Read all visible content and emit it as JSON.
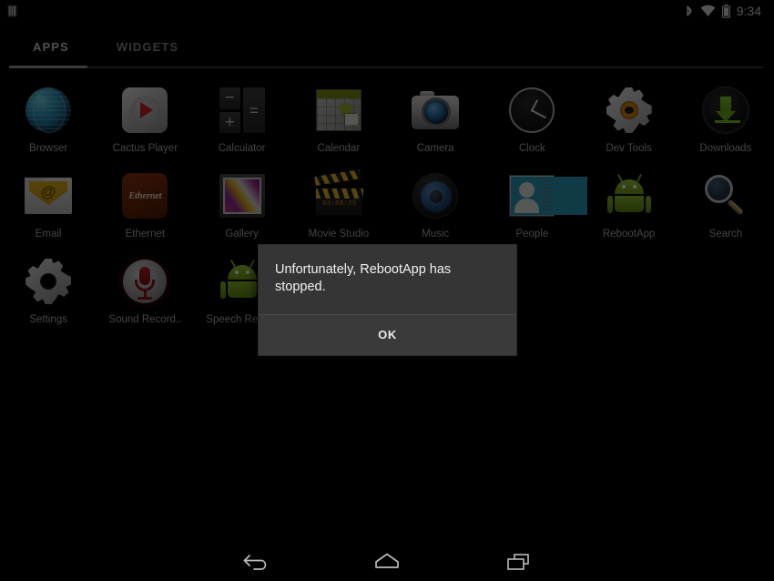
{
  "status_bar": {
    "notification_icon": "notification-bars-icon",
    "bluetooth_icon": "bluetooth-icon",
    "wifi_icon": "wifi-icon",
    "battery_icon": "battery-icon",
    "time": "9:34"
  },
  "tabs": [
    {
      "label": "APPS",
      "active": true
    },
    {
      "label": "WIDGETS",
      "active": false
    }
  ],
  "apps": [
    {
      "label": "Browser",
      "icon": "browser-globe-icon"
    },
    {
      "label": "Cactus Player",
      "icon": "cactus-player-icon"
    },
    {
      "label": "Calculator",
      "icon": "calculator-icon"
    },
    {
      "label": "Calendar",
      "icon": "calendar-icon"
    },
    {
      "label": "Camera",
      "icon": "camera-icon"
    },
    {
      "label": "Clock",
      "icon": "clock-icon"
    },
    {
      "label": "Dev Tools",
      "icon": "dev-tools-gear-icon"
    },
    {
      "label": "Downloads",
      "icon": "downloads-arrow-icon"
    },
    {
      "label": "Email",
      "icon": "email-envelope-icon"
    },
    {
      "label": "Ethernet",
      "icon": "ethernet-icon"
    },
    {
      "label": "Gallery",
      "icon": "gallery-photo-icon"
    },
    {
      "label": "Movie Studio",
      "icon": "movie-studio-clapperboard-icon"
    },
    {
      "label": "Music",
      "icon": "music-speaker-icon"
    },
    {
      "label": "People",
      "icon": "people-contact-card-icon"
    },
    {
      "label": "RebootApp",
      "icon": "android-robot-icon"
    },
    {
      "label": "Search",
      "icon": "search-magnifier-icon"
    },
    {
      "label": "Settings",
      "icon": "settings-gear-icon"
    },
    {
      "label": "Sound Record..",
      "icon": "sound-recorder-mic-icon"
    },
    {
      "label": "Speech Recor..",
      "icon": "android-robot-icon"
    }
  ],
  "calculator_keys": {
    "minus": "−",
    "plus": "+",
    "equals": "="
  },
  "ethernet_icon_text": "Ethernet",
  "movie_studio_timecode": "03:08:25",
  "dialog": {
    "message": "Unfortunately, RebootApp has stopped.",
    "buttons": [
      {
        "label": "OK"
      }
    ]
  },
  "nav_bar": {
    "back_icon": "back-arrow-icon",
    "home_icon": "home-icon",
    "recents_icon": "recent-apps-icon"
  },
  "colors": {
    "background": "#000000",
    "dialog_bg": "#353535",
    "tab_active": "#cfcfcf",
    "tab_inactive": "#8c8c8c",
    "label": "#b4b4b4"
  }
}
